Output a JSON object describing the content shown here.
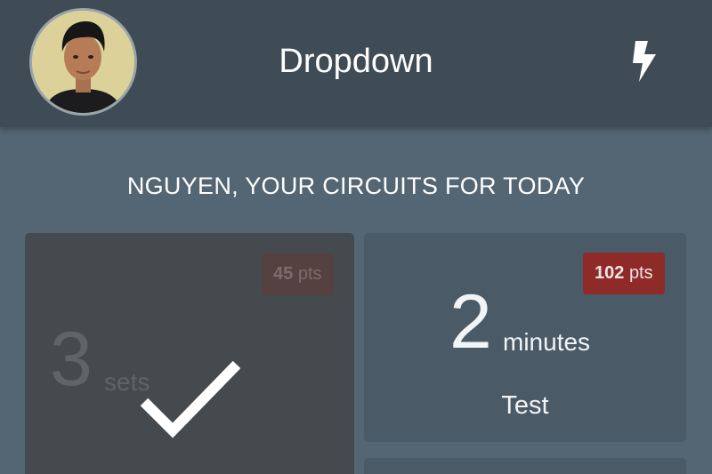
{
  "header": {
    "title": "Dropdown",
    "avatar_icon": "user-avatar",
    "action_icon": "lightning-bolt-icon"
  },
  "section": {
    "title": "NGUYEN, YOUR CIRCUITS FOR TODAY"
  },
  "circuits": [
    {
      "points_value": "45",
      "points_unit": "pts",
      "amount": "3",
      "unit": "sets",
      "name": "",
      "completed": true,
      "status_icon": "checkmark-icon"
    },
    {
      "points_value": "102",
      "points_unit": "pts",
      "amount": "2",
      "unit": "minutes",
      "name": "Test",
      "completed": false
    }
  ],
  "colors": {
    "header_bg": "#3f4c56",
    "page_bg": "#546673",
    "points_badge": "#8e2a27"
  }
}
